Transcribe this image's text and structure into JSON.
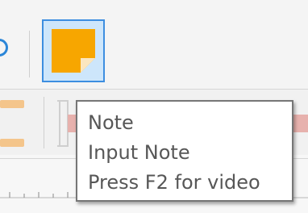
{
  "colors": {
    "toolbar_bg": "#f4f4f4",
    "selected_button_bg": "#cde6fb",
    "selected_button_border": "#3d8ee0",
    "note_icon_orange": "#f7a600",
    "tooltip_text": "#575757",
    "tooltip_border": "#767676"
  },
  "icons": {
    "partial": "partial-circle-icon",
    "note": "sticky-note-icon"
  },
  "tooltip": {
    "lines": [
      "Note",
      "Input Note",
      "Press F2 for video"
    ]
  }
}
